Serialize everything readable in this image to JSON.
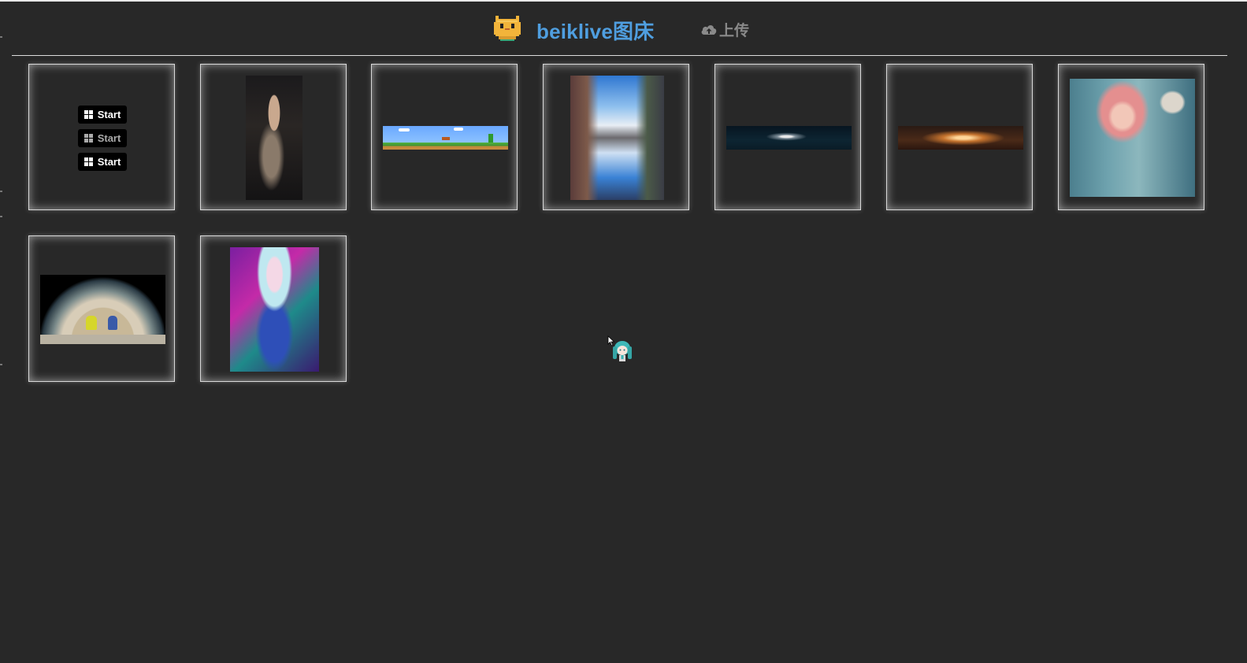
{
  "header": {
    "logo_icon": "pixel-cat-icon",
    "site_title": "beiklive图床",
    "upload_label": "上传",
    "upload_icon": "cloud-upload-icon",
    "title_color": "#4f9edf"
  },
  "gallery": {
    "images": [
      {
        "name": "start-button-sprite",
        "buttons": [
          "Start",
          "Start",
          "Start"
        ]
      },
      {
        "name": "dark-haired-girl-portrait"
      },
      {
        "name": "mario-level-banner"
      },
      {
        "name": "street-reflection-sky"
      },
      {
        "name": "white-dragon-banner"
      },
      {
        "name": "winged-figure-banner"
      },
      {
        "name": "pink-haired-girl-painting"
      },
      {
        "name": "earth-astronauts"
      },
      {
        "name": "anime-girl-neon"
      }
    ]
  },
  "mascot_icon": "miku-mascot-icon",
  "background_color": "#282828"
}
